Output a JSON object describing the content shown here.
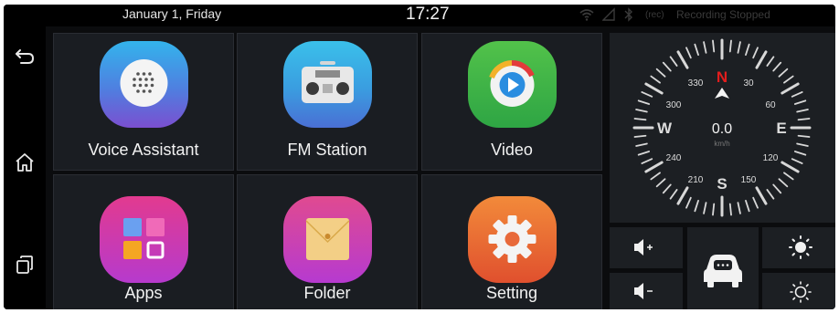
{
  "status_bar": {
    "date": "January 1, Friday",
    "time": "17:27",
    "rec_badge": "(rec)",
    "recording_status": "Recording Stopped"
  },
  "nav": {
    "back_icon": "back-arrow-icon",
    "home_icon": "home-icon",
    "recent_icon": "recent-apps-icon"
  },
  "apps": [
    {
      "label": "Voice Assistant",
      "icon": "microphone-icon"
    },
    {
      "label": "FM Station",
      "icon": "radio-icon"
    },
    {
      "label": "Video",
      "icon": "play-icon"
    },
    {
      "label": "Apps",
      "icon": "apps-grid-icon"
    },
    {
      "label": "Folder",
      "icon": "folder-icon"
    },
    {
      "label": "Setting",
      "icon": "gear-icon"
    }
  ],
  "compass": {
    "north": "N",
    "south": "S",
    "east": "E",
    "west": "W",
    "deg_30": "30",
    "deg_60": "60",
    "deg_120": "120",
    "deg_150": "150",
    "deg_210": "210",
    "deg_240": "240",
    "deg_300": "300",
    "deg_330": "330",
    "speed": "0.0",
    "speed_unit": "km/h"
  },
  "controls": {
    "volume_up": "volume-up-icon",
    "volume_down": "volume-down-icon",
    "car_icon": "car-message-icon",
    "brightness_up": "brightness-high-icon",
    "brightness_down": "brightness-low-icon"
  },
  "colors": {
    "accent_red": "#e11d1d",
    "tile_bg": "#1a1d22",
    "screen_bg": "#0b0c0e"
  }
}
